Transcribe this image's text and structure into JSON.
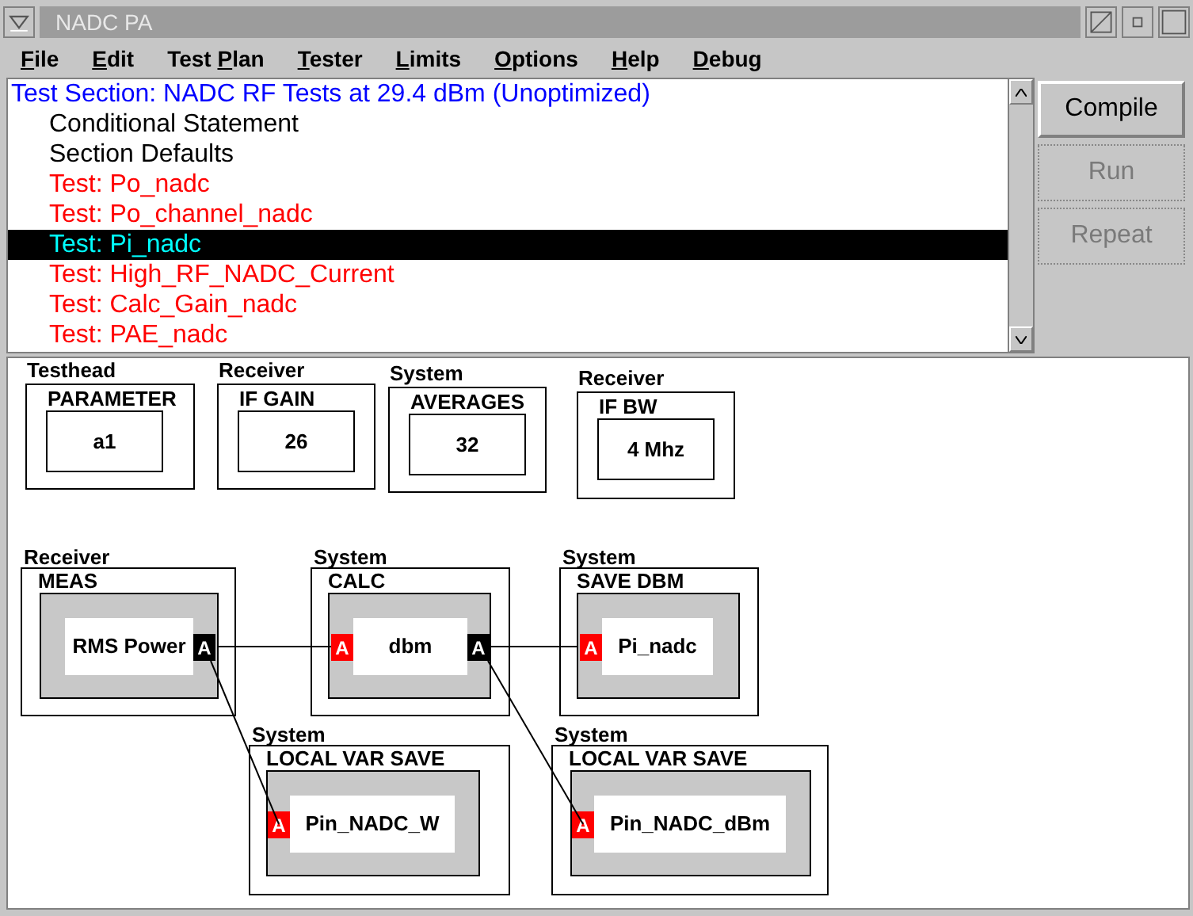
{
  "window": {
    "title": "NADC PA"
  },
  "menu": [
    {
      "key": "F",
      "rest": "ile"
    },
    {
      "key": "E",
      "rest": "dit"
    },
    {
      "prefix": "Test ",
      "key": "P",
      "rest": "lan"
    },
    {
      "key": "T",
      "rest": "ester"
    },
    {
      "key": "L",
      "rest": "imits"
    },
    {
      "key": "O",
      "rest": "ptions"
    },
    {
      "key": "H",
      "rest": "elp"
    },
    {
      "key": "D",
      "rest": "ebug"
    }
  ],
  "test_list": [
    {
      "text": "Test Section: NADC RF Tests at 29.4 dBm (Unoptimized)",
      "kind": "section",
      "selected": false
    },
    {
      "text": "Conditional Statement",
      "kind": "item",
      "selected": false
    },
    {
      "text": "Section Defaults",
      "kind": "item",
      "selected": false
    },
    {
      "text": "Test: Po_nadc",
      "kind": "test",
      "selected": false
    },
    {
      "text": "Test: Po_channel_nadc",
      "kind": "test",
      "selected": false
    },
    {
      "text": "Test: Pi_nadc",
      "kind": "test",
      "selected": true
    },
    {
      "text": "Test: High_RF_NADC_Current",
      "kind": "test",
      "selected": false
    },
    {
      "text": "Test: Calc_Gain_nadc",
      "kind": "test",
      "selected": false
    },
    {
      "text": "Test: PAE_nadc",
      "kind": "test",
      "selected": false
    }
  ],
  "buttons": [
    {
      "label": "Compile",
      "disabled": false
    },
    {
      "label": "Run",
      "disabled": true
    },
    {
      "label": "Repeat",
      "disabled": true
    }
  ],
  "parameters": [
    {
      "category": "Testhead",
      "title": "PARAMETER",
      "value": "a1"
    },
    {
      "category": "Receiver",
      "title": "IF GAIN",
      "value": "26"
    },
    {
      "category": "System",
      "title": "AVERAGES",
      "value": "32"
    },
    {
      "category": "Receiver",
      "title": "IF BW",
      "value": "4 Mhz"
    }
  ],
  "blocks": [
    {
      "category": "Receiver",
      "title": "MEAS",
      "label": "RMS Power",
      "ports": [
        {
          "text": "A",
          "kind": "output"
        }
      ]
    },
    {
      "category": "System",
      "title": "CALC",
      "label": "dbm",
      "ports": [
        {
          "text": "A",
          "kind": "input"
        },
        {
          "text": "A",
          "kind": "output"
        }
      ]
    },
    {
      "category": "System",
      "title": "SAVE DBM",
      "label": "Pi_nadc",
      "ports": [
        {
          "text": "A",
          "kind": "input"
        }
      ]
    },
    {
      "category": "System",
      "title": "LOCAL VAR SAVE",
      "label": "Pin_NADC_W",
      "ports": [
        {
          "text": "A",
          "kind": "input"
        }
      ]
    },
    {
      "category": "System",
      "title": "LOCAL VAR SAVE",
      "label": "Pin_NADC_dBm",
      "ports": [
        {
          "text": "A",
          "kind": "input"
        }
      ]
    }
  ]
}
